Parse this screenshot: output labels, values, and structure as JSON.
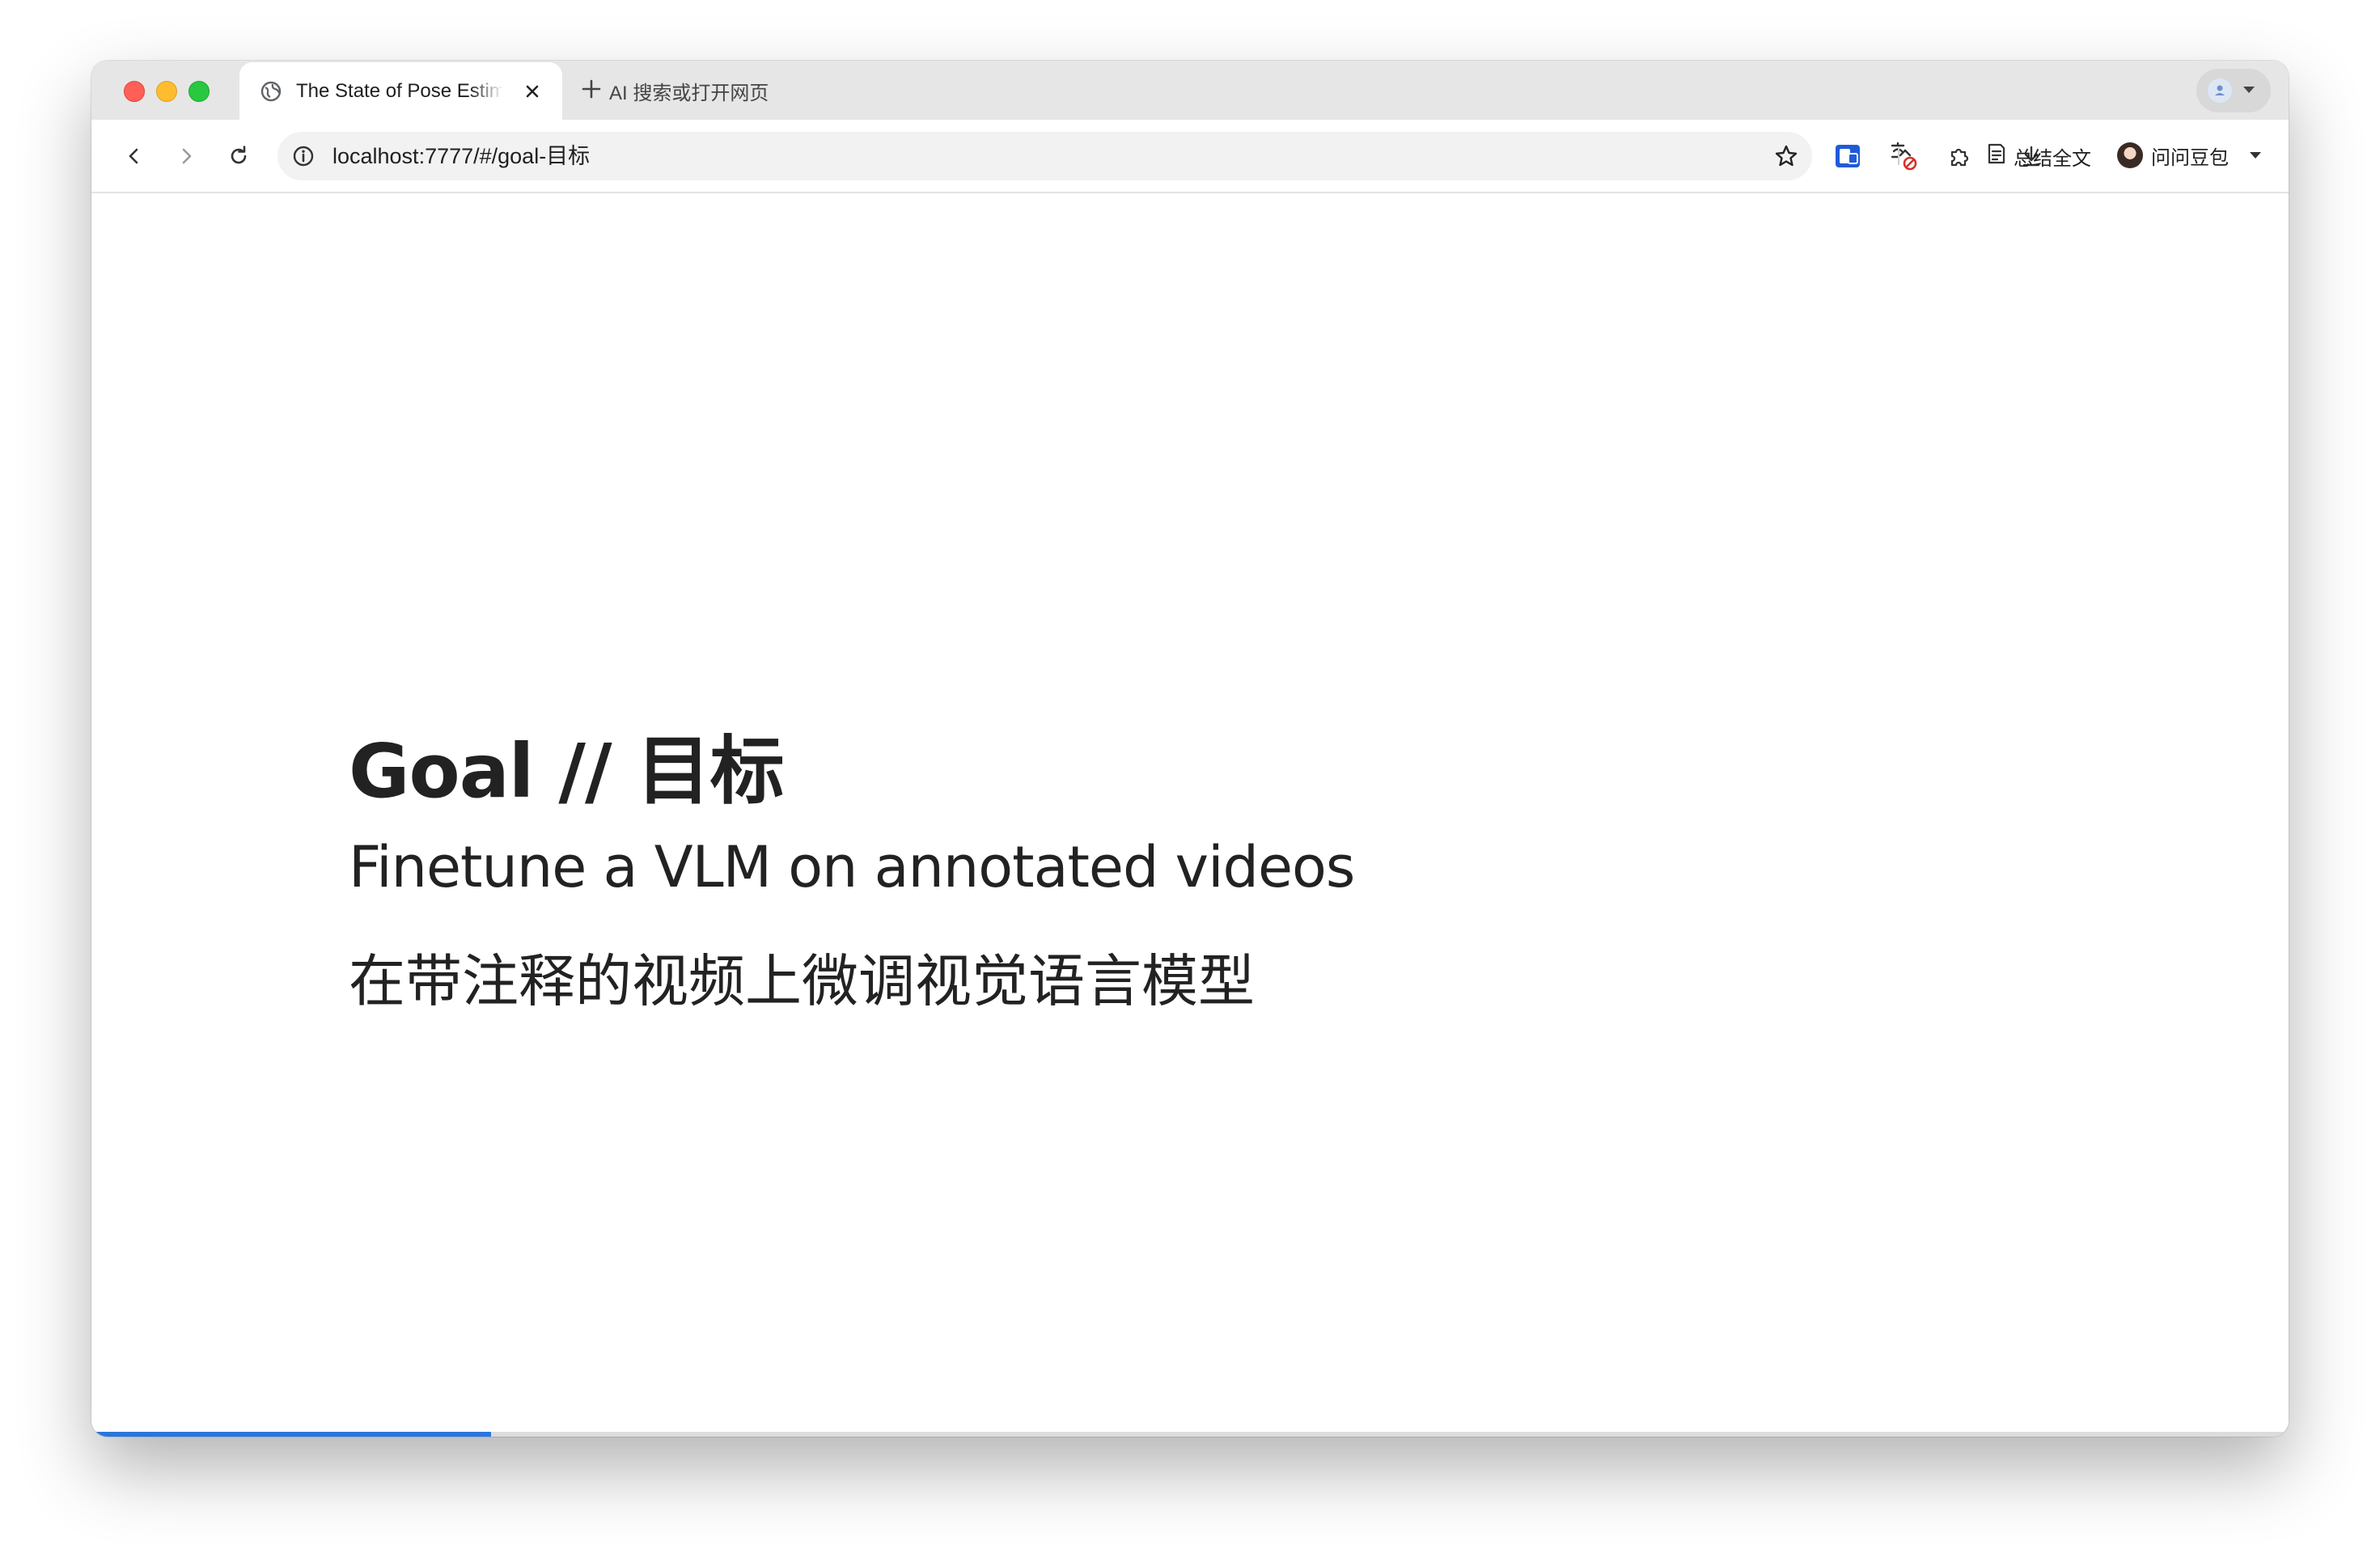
{
  "browser": {
    "tab": {
      "title": "The State of Pose Estimation",
      "close_icon": "close-icon",
      "favicon": "globe-icon"
    },
    "new_tab": {
      "label": "AI 搜索或打开网页",
      "icon": "plus-icon"
    },
    "address_bar": {
      "url": "localhost:7777/#/goal-目标"
    },
    "toolbar": {
      "summarize_label": "总结全文",
      "doubao_label": "问问豆包"
    }
  },
  "slide": {
    "title": "Goal // 目标",
    "line_en": "Finetune a VLM on annotated videos",
    "line_zh": "在带注释的视频上微调视觉语言模型"
  },
  "progress": {
    "fraction": 0.182,
    "color": "#2a76dd"
  },
  "colors": {
    "accent": "#2a76dd",
    "text": "#222222",
    "tabstrip": "#e6e6e6"
  }
}
